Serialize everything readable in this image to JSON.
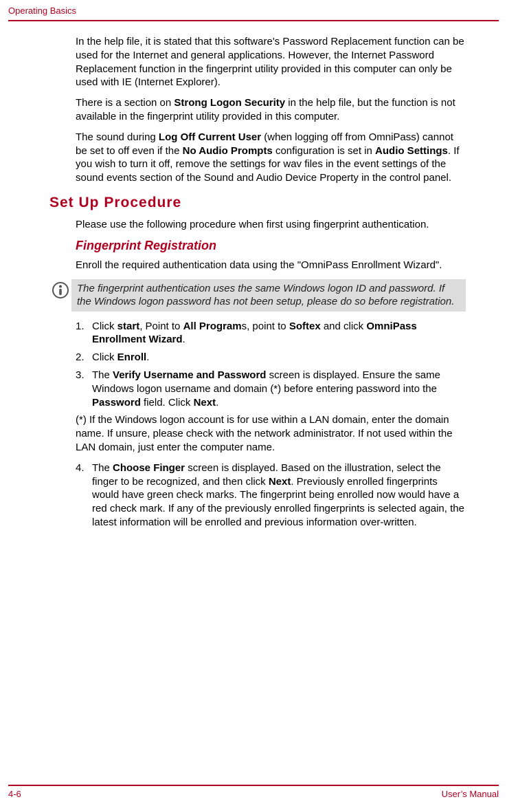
{
  "header": {
    "title": "Operating Basics"
  },
  "p1": {
    "text": "In the help file, it is stated that this software's Password Replacement function can be used for the Internet and general applications. However, the Internet Password Replacement function in the fingerprint utility provided in this computer can only be used with IE (Internet Explorer)."
  },
  "p2": {
    "pre": "There is a section on ",
    "b1": "Strong Logon Security",
    "post": " in the help file, but the function is not available in the fingerprint utility provided in this computer."
  },
  "p3": {
    "pre": "The sound during ",
    "b1": "Log Off Current User",
    "mid1": " (when logging off from OmniPass) cannot be set to off even if the ",
    "b2": "No Audio Prompts",
    "mid2": " configuration is set in ",
    "b3": "Audio Settings",
    "post": ". If you wish to turn it off, remove the settings for wav files in the event settings of the sound events section of the Sound and Audio Device Property in the control panel."
  },
  "section": {
    "title": "Set Up Procedure"
  },
  "p4": {
    "text": "Please use the following procedure when first using fingerprint authentication."
  },
  "sub": {
    "title": "Fingerprint Registration"
  },
  "p5": {
    "text": "Enroll the required authentication data using the \"OmniPass Enrollment Wizard\"."
  },
  "note": {
    "text": "The fingerprint authentication uses the same Windows logon ID and password. If the Windows logon password has not been setup, please do so before registration."
  },
  "s1": {
    "num": "1.",
    "pre": "Click ",
    "b1": "start",
    "mid1": ", Point to ",
    "b2": "All Program",
    "mid2": "s, point to ",
    "b3": "Softex",
    "mid3": " and click ",
    "b4": "OmniPass Enrollment Wizard",
    "post": "."
  },
  "s2": {
    "num": "2.",
    "pre": "Click ",
    "b1": "Enroll",
    "post": "."
  },
  "s3": {
    "num": "3.",
    "pre": "The ",
    "b1": "Verify Username and Password",
    "mid1": " screen is displayed. Ensure the same Windows logon username and domain (*) before entering password into the ",
    "b2": "Password",
    "mid2": " field. Click ",
    "b3": "Next",
    "post": "."
  },
  "p6": {
    "text": "(*) If the Windows logon account is for use within a LAN domain, enter the domain name. If unsure, please check with the network administrator. If not used within the LAN domain, just enter the computer name."
  },
  "s4": {
    "num": "4.",
    "pre": "The ",
    "b1": "Choose Finger",
    "mid1": " screen is displayed. Based on the illustration, select the finger to be recognized, and then click ",
    "b2": "Next",
    "post": ". Previously enrolled fingerprints would have green check marks. The fingerprint being enrolled now would have a red check mark. If any of the previously enrolled fingerprints is selected again, the latest information will be enrolled and previous information over-written."
  },
  "footer": {
    "left": "4-6",
    "right": "User’s Manual"
  }
}
